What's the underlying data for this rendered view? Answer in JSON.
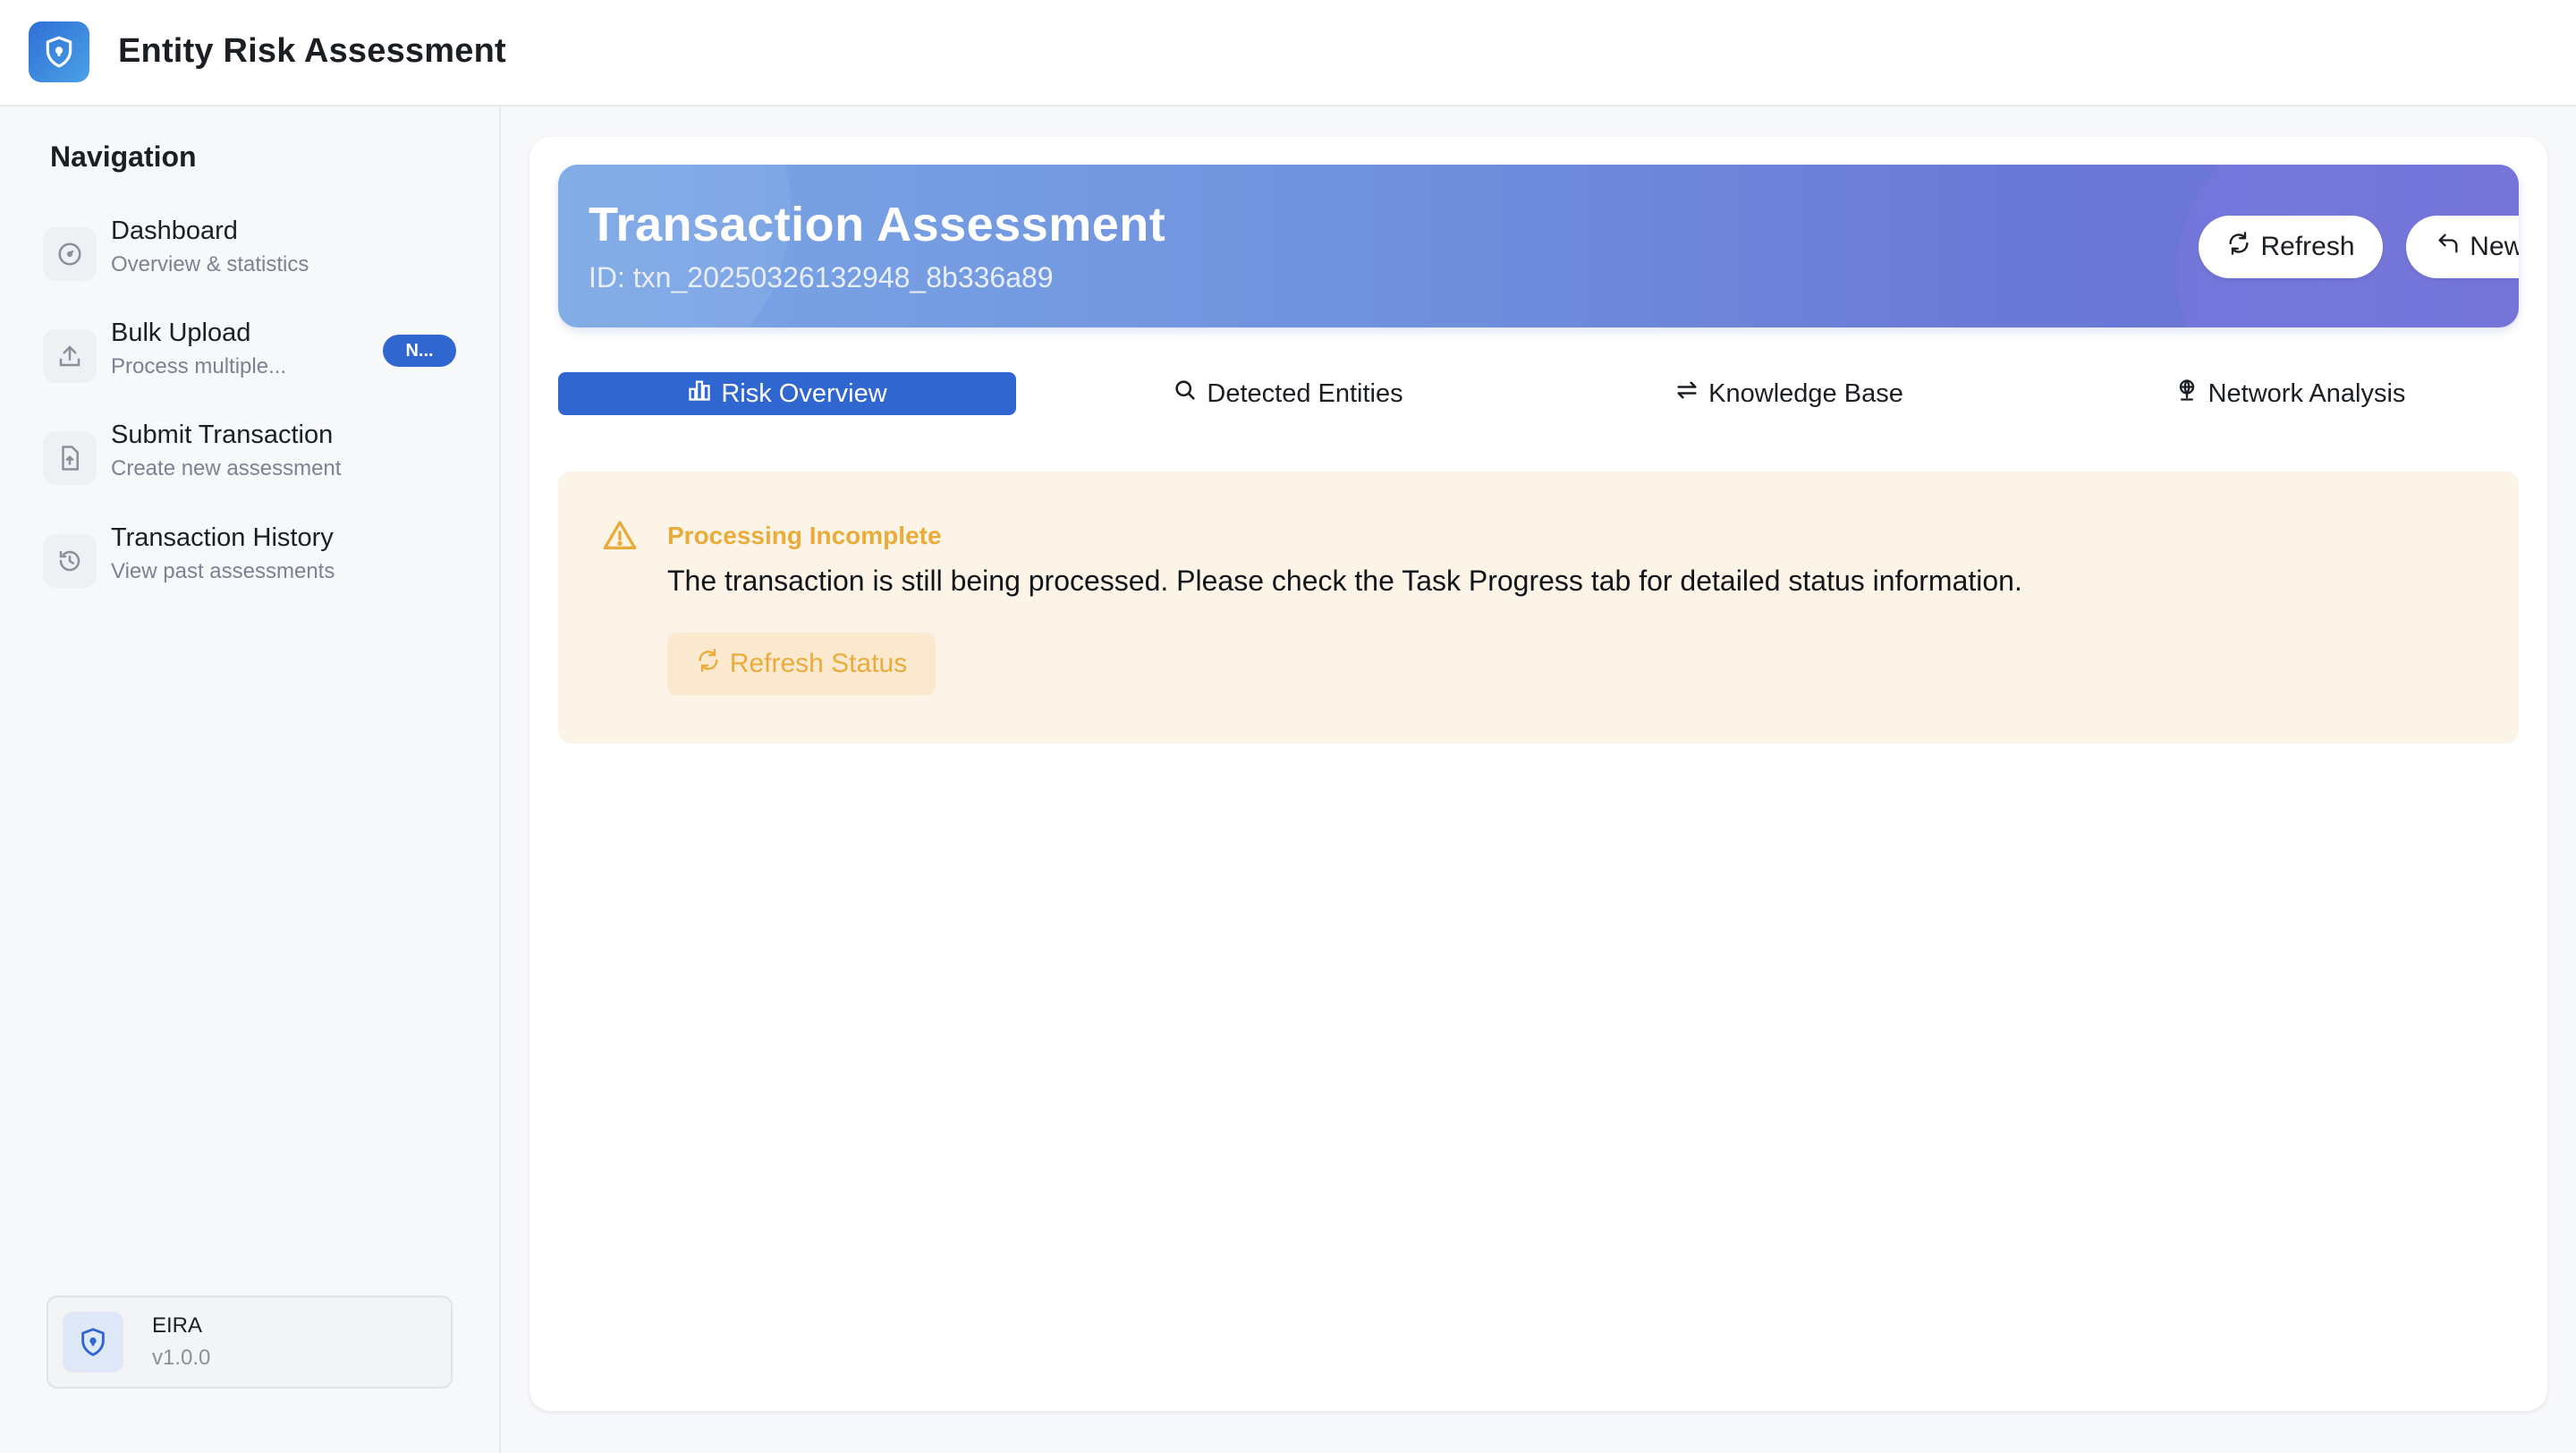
{
  "app": {
    "title": "Entity Risk Assessment",
    "logo_icon": "shield-icon",
    "accent": "#2f66d0"
  },
  "sidebar": {
    "heading": "Navigation",
    "items": [
      {
        "label": "Dashboard",
        "sub": "Overview & statistics",
        "icon": "gauge-icon"
      },
      {
        "label": "Bulk Upload",
        "sub": "Process multiple...",
        "icon": "upload-icon",
        "badge": "N..."
      },
      {
        "label": "Submit Transaction",
        "sub": "Create new assessment",
        "icon": "file-upload-icon"
      },
      {
        "label": "Transaction History",
        "sub": "View past assessments",
        "icon": "history-icon"
      }
    ],
    "footer": {
      "name": "EIRA",
      "version": "v1.0.0",
      "icon": "shield-icon"
    }
  },
  "hero": {
    "title": "Transaction Assessment",
    "id_text": "ID: txn_20250326132948_8b336a89",
    "refresh_label": "Refresh",
    "new_label": "New Transaction"
  },
  "tabs": [
    {
      "label": "Risk Overview",
      "icon": "bar-chart-icon",
      "active": true
    },
    {
      "label": "Detected Entities",
      "icon": "search-icon",
      "active": false
    },
    {
      "label": "Knowledge Base",
      "icon": "swap-arrows-icon",
      "active": false
    },
    {
      "label": "Network Analysis",
      "icon": "globe-pin-icon",
      "active": false
    }
  ],
  "alert": {
    "title": "Processing Incomplete",
    "message": "The transaction is still being processed. Please check the Task Progress tab for detailed status information.",
    "button_label": "Refresh Status",
    "color": "#e9ac3a"
  }
}
